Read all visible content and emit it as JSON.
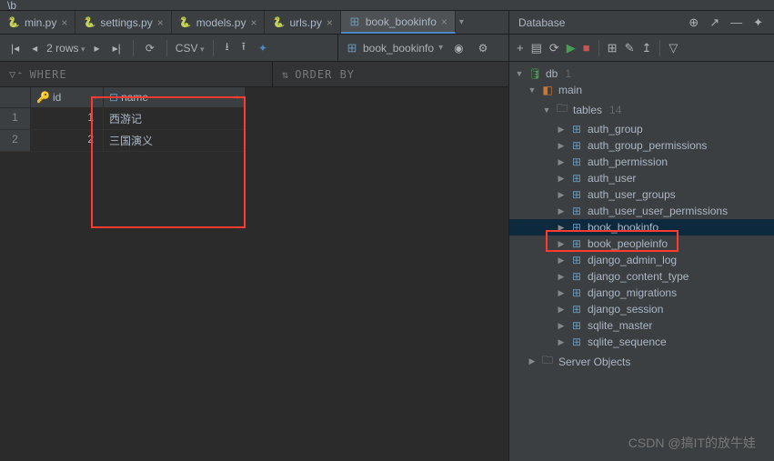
{
  "topLeft": "\\b",
  "tabs": [
    {
      "label": "min.py",
      "icon": "python"
    },
    {
      "label": "settings.py",
      "icon": "python"
    },
    {
      "label": "models.py",
      "icon": "python"
    },
    {
      "label": "urls.py",
      "icon": "python"
    },
    {
      "label": "book_bookinfo",
      "icon": "table",
      "active": true
    }
  ],
  "toolbar": {
    "rows": "2 rows",
    "csv": "CSV"
  },
  "filters": {
    "where": "WHERE",
    "orderBy": "ORDER BY"
  },
  "table": {
    "columns": [
      "id",
      "name"
    ],
    "rows": [
      {
        "n": "1",
        "id": "1",
        "name": "西游记"
      },
      {
        "n": "2",
        "id": "2",
        "name": "三国演义"
      }
    ]
  },
  "context": {
    "source": "book_bookinfo"
  },
  "dbPanel": {
    "title": "Database",
    "rootName": "db",
    "rootCount": "1",
    "schema": "main",
    "tablesLabel": "tables",
    "tablesCount": "14",
    "tables": [
      "auth_group",
      "auth_group_permissions",
      "auth_permission",
      "auth_user",
      "auth_user_groups",
      "auth_user_user_permissions",
      "book_bookinfo",
      "book_peopleinfo",
      "django_admin_log",
      "django_content_type",
      "django_migrations",
      "django_session",
      "sqlite_master",
      "sqlite_sequence"
    ],
    "serverObjects": "Server Objects"
  },
  "watermark": "CSDN @搞IT的放牛娃"
}
